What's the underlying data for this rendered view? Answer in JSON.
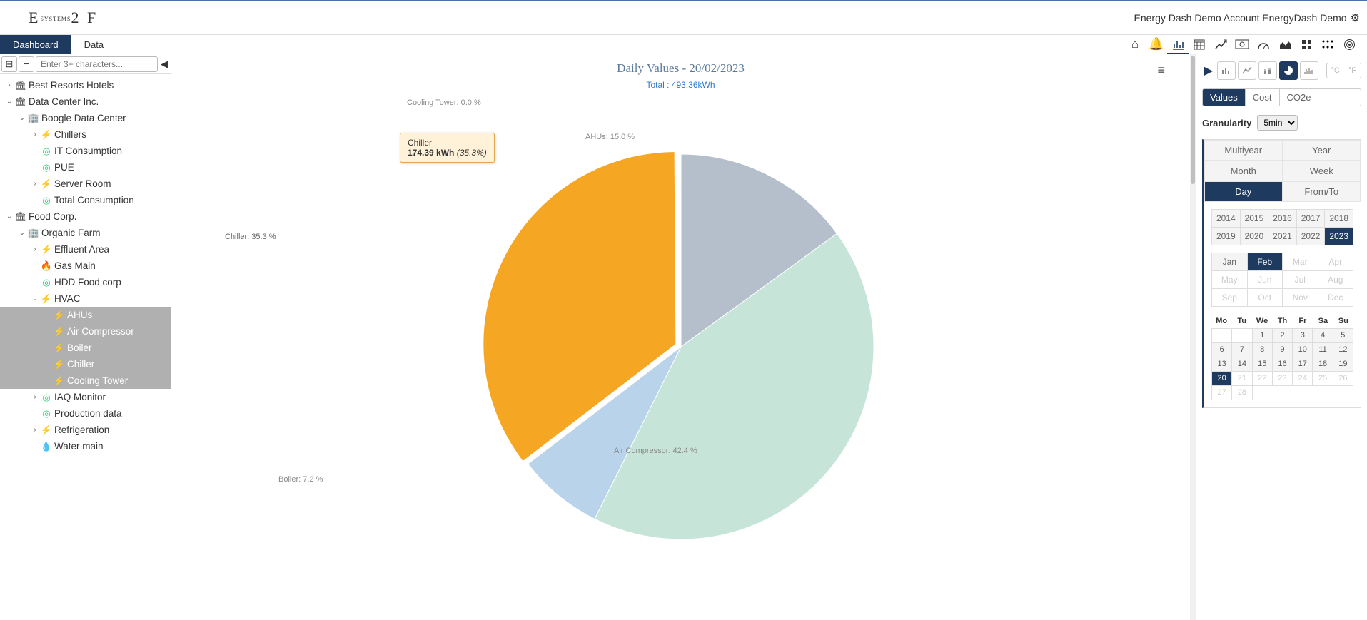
{
  "header": {
    "logo_pre": "E",
    "logo_sys": "SYSTEMS",
    "logo_post": "2 F",
    "account": "Energy Dash Demo Account EnergyDash Demo"
  },
  "nav": {
    "tabs": [
      {
        "label": "Dashboard",
        "active": true
      },
      {
        "label": "Data",
        "active": false
      }
    ]
  },
  "sidebar": {
    "search_placeholder": "Enter 3+ characters..."
  },
  "tree": [
    {
      "depth": 0,
      "caret": "right",
      "icon": "bank",
      "label": "Best Resorts Hotels"
    },
    {
      "depth": 0,
      "caret": "down",
      "icon": "bank",
      "label": "Data Center Inc."
    },
    {
      "depth": 1,
      "caret": "down",
      "icon": "building",
      "label": "Boogle Data Center"
    },
    {
      "depth": 2,
      "caret": "right",
      "icon": "bolt",
      "label": "Chillers"
    },
    {
      "depth": 2,
      "caret": "",
      "icon": "target",
      "label": "IT Consumption"
    },
    {
      "depth": 2,
      "caret": "",
      "icon": "target",
      "label": "PUE"
    },
    {
      "depth": 2,
      "caret": "right",
      "icon": "bolt",
      "label": "Server Room"
    },
    {
      "depth": 2,
      "caret": "",
      "icon": "target",
      "label": "Total Consumption"
    },
    {
      "depth": 0,
      "caret": "down",
      "icon": "bank",
      "label": "Food Corp."
    },
    {
      "depth": 1,
      "caret": "down",
      "icon": "building",
      "label": "Organic Farm"
    },
    {
      "depth": 2,
      "caret": "right",
      "icon": "bolt",
      "label": "Effluent Area"
    },
    {
      "depth": 2,
      "caret": "",
      "icon": "flame",
      "label": "Gas Main"
    },
    {
      "depth": 2,
      "caret": "",
      "icon": "target",
      "label": "HDD Food corp"
    },
    {
      "depth": 2,
      "caret": "down",
      "icon": "bolt",
      "label": "HVAC"
    },
    {
      "depth": 3,
      "caret": "",
      "icon": "bolt",
      "label": "AHUs",
      "selected": true
    },
    {
      "depth": 3,
      "caret": "",
      "icon": "bolt",
      "label": "Air Compressor",
      "selected": true
    },
    {
      "depth": 3,
      "caret": "",
      "icon": "bolt",
      "label": "Boiler",
      "selected": true
    },
    {
      "depth": 3,
      "caret": "",
      "icon": "bolt",
      "label": "Chiller",
      "selected": true
    },
    {
      "depth": 3,
      "caret": "",
      "icon": "bolt",
      "label": "Cooling Tower",
      "selected": true
    },
    {
      "depth": 2,
      "caret": "right",
      "icon": "target",
      "label": "IAQ Monitor"
    },
    {
      "depth": 2,
      "caret": "",
      "icon": "target",
      "label": "Production data"
    },
    {
      "depth": 2,
      "caret": "right",
      "icon": "bolt",
      "label": "Refrigeration"
    },
    {
      "depth": 2,
      "caret": "",
      "icon": "drop",
      "label": "Water main"
    }
  ],
  "chart": {
    "title": "Daily Values - 20/02/2023",
    "subtitle": "Total : 493.36kWh",
    "tooltip": {
      "name": "Chiller",
      "value": "174.39 kWh",
      "pct": "(35.3%)"
    }
  },
  "chart_data": {
    "type": "pie",
    "title": "Daily Values - 20/02/2023",
    "total_kwh": 493.36,
    "series": [
      {
        "name": "AHUs",
        "percent": 15.0,
        "kwh": 74.0,
        "color": "#b5bfcb",
        "label": "AHUs: 15.0 %"
      },
      {
        "name": "Air Compressor",
        "percent": 42.4,
        "kwh": 209.2,
        "color": "#c6e5d8",
        "label": "Air Compressor: 42.4 %"
      },
      {
        "name": "Boiler",
        "percent": 7.2,
        "kwh": 35.5,
        "color": "#b8d3ea",
        "label": "Boiler: 7.2 %"
      },
      {
        "name": "Chiller",
        "percent": 35.3,
        "kwh": 174.39,
        "color": "#f5a623",
        "label": "Chiller: 35.3 %",
        "exploded": true
      },
      {
        "name": "Cooling Tower",
        "percent": 0.0,
        "kwh": 0.0,
        "color": "#f3c987",
        "label": "Cooling Tower: 0.0 %"
      }
    ]
  },
  "rpanel": {
    "metrics": [
      {
        "label": "Values",
        "active": true
      },
      {
        "label": "Cost",
        "active": false
      },
      {
        "label": "CO2e",
        "active": false
      }
    ],
    "granularity_label": "Granularity",
    "granularity_value": "5min",
    "periods": [
      "Multiyear",
      "Year",
      "Month",
      "Week",
      "Day",
      "From/To"
    ],
    "period_active": "Day",
    "years": [
      "2014",
      "2015",
      "2016",
      "2017",
      "2018",
      "2019",
      "2020",
      "2021",
      "2022",
      "2023"
    ],
    "year_active": "2023",
    "months": [
      "Jan",
      "Feb",
      "Mar",
      "Apr",
      "May",
      "Jun",
      "Jul",
      "Aug",
      "Sep",
      "Oct",
      "Nov",
      "Dec"
    ],
    "month_active": "Feb",
    "months_enabled_until": 2,
    "dow": [
      "Mo",
      "Tu",
      "We",
      "Th",
      "Fr",
      "Sa",
      "Su"
    ],
    "day_active": 20,
    "days_in_month": 28,
    "first_dow_offset": 2,
    "units": [
      "°C",
      "°F"
    ]
  }
}
